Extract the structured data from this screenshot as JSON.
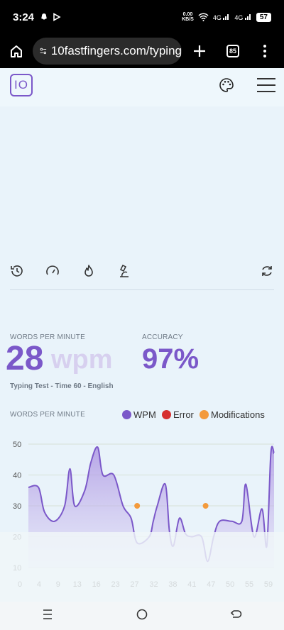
{
  "status": {
    "time": "3:24",
    "net_speed_top": "0.00",
    "net_speed_bottom": "KB/S",
    "signal1": "4G",
    "signal2": "4G",
    "battery": "57"
  },
  "browser": {
    "url": "10fastfingers.com/typing",
    "tab_count": "85"
  },
  "site": {
    "logo": "IO"
  },
  "results": {
    "wpm_label": "WORDS PER MINUTE",
    "wpm_value": "28",
    "wpm_unit": "wpm",
    "accuracy_label": "ACCURACY",
    "accuracy_value": "97%",
    "test_info": "Typing Test - Time 60 - English"
  },
  "chart_data": {
    "type": "line",
    "title": "WORDS PER MINUTE",
    "legend": [
      "WPM",
      "Error",
      "Modifications"
    ],
    "colors": {
      "wpm": "#7b58c9",
      "error": "#d62f2f",
      "modifications": "#f39a3c"
    },
    "x_ticks": [
      "0",
      "4",
      "9",
      "13",
      "16",
      "23",
      "27",
      "32",
      "38",
      "41",
      "47",
      "50",
      "55",
      "59"
    ],
    "y_ticks": [
      10,
      20,
      30,
      40,
      50
    ],
    "ylim": [
      10,
      52
    ],
    "series": [
      {
        "name": "WPM",
        "points": [
          [
            0,
            36
          ],
          [
            2.5,
            36
          ],
          [
            4,
            28
          ],
          [
            6.5,
            25
          ],
          [
            9,
            30
          ],
          [
            10.3,
            42
          ],
          [
            11.5,
            30
          ],
          [
            14,
            35
          ],
          [
            15.5,
            44
          ],
          [
            17.2,
            49
          ],
          [
            18.5,
            40
          ],
          [
            21.2,
            40
          ],
          [
            23.5,
            30
          ],
          [
            25.5,
            26
          ],
          [
            27,
            18
          ],
          [
            30,
            20
          ],
          [
            31,
            25
          ],
          [
            32,
            30
          ],
          [
            34,
            37
          ],
          [
            35,
            22
          ],
          [
            36,
            17
          ],
          [
            37.5,
            26
          ],
          [
            39,
            21
          ],
          [
            40.5,
            20
          ],
          [
            43,
            20
          ],
          [
            44.5,
            12
          ],
          [
            46,
            20
          ],
          [
            47.5,
            25
          ],
          [
            50.5,
            25
          ],
          [
            53,
            25
          ],
          [
            54,
            37
          ],
          [
            56,
            20
          ],
          [
            58,
            29
          ],
          [
            59.2,
            17
          ],
          [
            60.2,
            47
          ],
          [
            61,
            47
          ]
        ]
      },
      {
        "name": "Modifications",
        "points": [
          [
            27,
            30
          ],
          [
            44,
            30
          ]
        ]
      }
    ]
  }
}
